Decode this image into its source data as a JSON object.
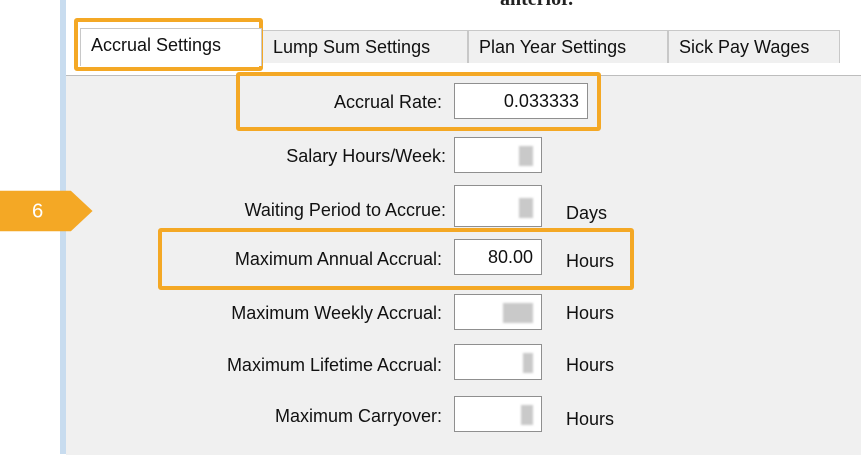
{
  "header": {
    "cut_text": "anterior."
  },
  "tabs": [
    {
      "label": "Accrual Settings"
    },
    {
      "label": "Lump Sum Settings"
    },
    {
      "label": "Plan Year Settings"
    },
    {
      "label": "Sick Pay Wages"
    }
  ],
  "fields": {
    "accrual_rate": {
      "label": "Accrual Rate:",
      "value": "0.033333"
    },
    "salary_hours_week": {
      "label": "Salary Hours/Week:"
    },
    "waiting_period": {
      "label": "Waiting Period to Accrue:",
      "unit": "Days"
    },
    "max_annual": {
      "label": "Maximum Annual Accrual:",
      "value": "80.00",
      "unit": "Hours"
    },
    "max_weekly": {
      "label": "Maximum Weekly Accrual:",
      "unit": "Hours"
    },
    "max_lifetime": {
      "label": "Maximum Lifetime Accrual:",
      "unit": "Hours"
    },
    "max_carryover": {
      "label": "Maximum Carryover:",
      "unit": "Hours"
    }
  },
  "callout": {
    "number": "6",
    "color": "#f4a825"
  }
}
